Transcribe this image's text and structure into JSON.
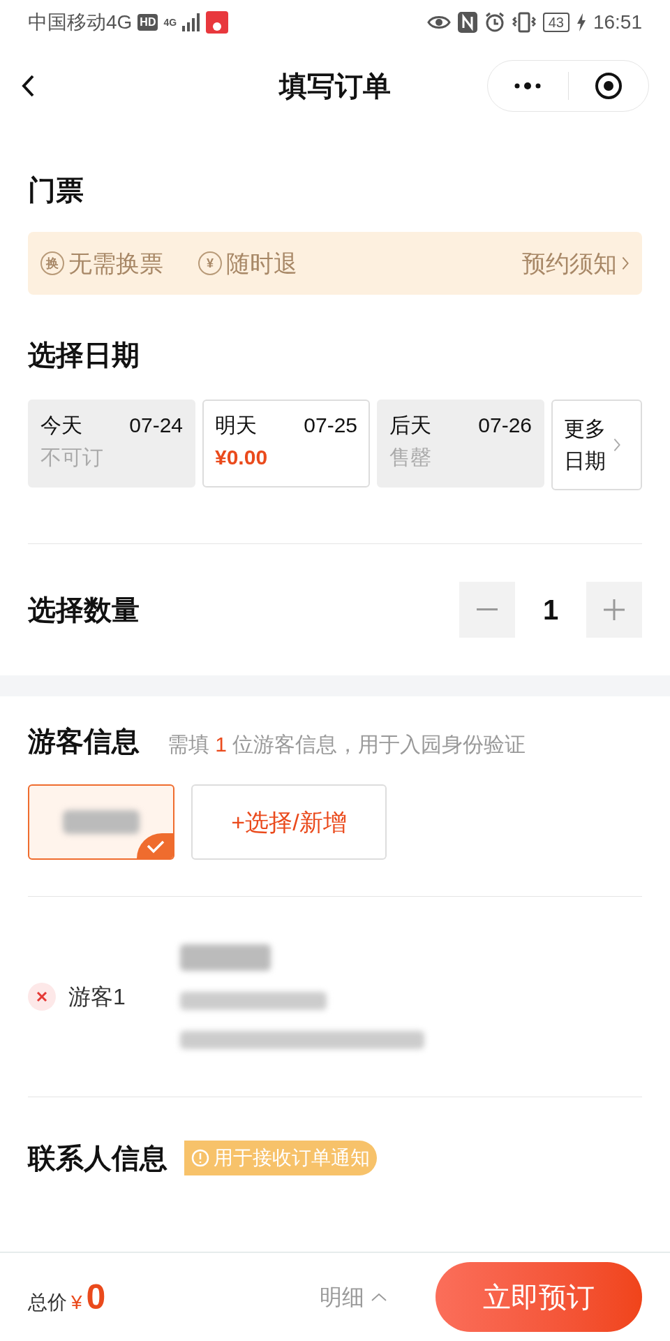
{
  "status_bar": {
    "carrier": "中国移动4G",
    "hd": "HD",
    "network": "4G",
    "battery": "43",
    "time": "16:51"
  },
  "header": {
    "title": "填写订单"
  },
  "tickets": {
    "title": "门票",
    "badges": [
      {
        "icon_char": "换",
        "label": "无需换票"
      },
      {
        "icon_char": "¥",
        "label": "随时退"
      }
    ],
    "notice_link": "预约须知"
  },
  "dates": {
    "title": "选择日期",
    "options": [
      {
        "day": "今天",
        "date": "07-24",
        "note": "不可订",
        "kind": "unavailable",
        "selected": false
      },
      {
        "day": "明天",
        "date": "07-25",
        "note": "¥0.00",
        "kind": "price",
        "selected": true
      },
      {
        "day": "后天",
        "date": "07-26",
        "note": "售罄",
        "kind": "unavailable",
        "selected": false
      }
    ],
    "more": "更多日期"
  },
  "quantity": {
    "title": "选择数量",
    "value": "1"
  },
  "guests": {
    "title": "游客信息",
    "hint_before": "需填",
    "count": "1",
    "hint_after": "位游客信息，用于入园身份验证",
    "cards": [
      {
        "selected": true
      }
    ],
    "add_button": "+选择/新增",
    "rows": [
      {
        "label": "游客1"
      }
    ]
  },
  "contact": {
    "title": "联系人信息",
    "tag": "用于接收订单通知"
  },
  "footer": {
    "total_label": "总价",
    "currency": "¥",
    "amount": "0",
    "details": "明细",
    "submit": "立即预订"
  }
}
